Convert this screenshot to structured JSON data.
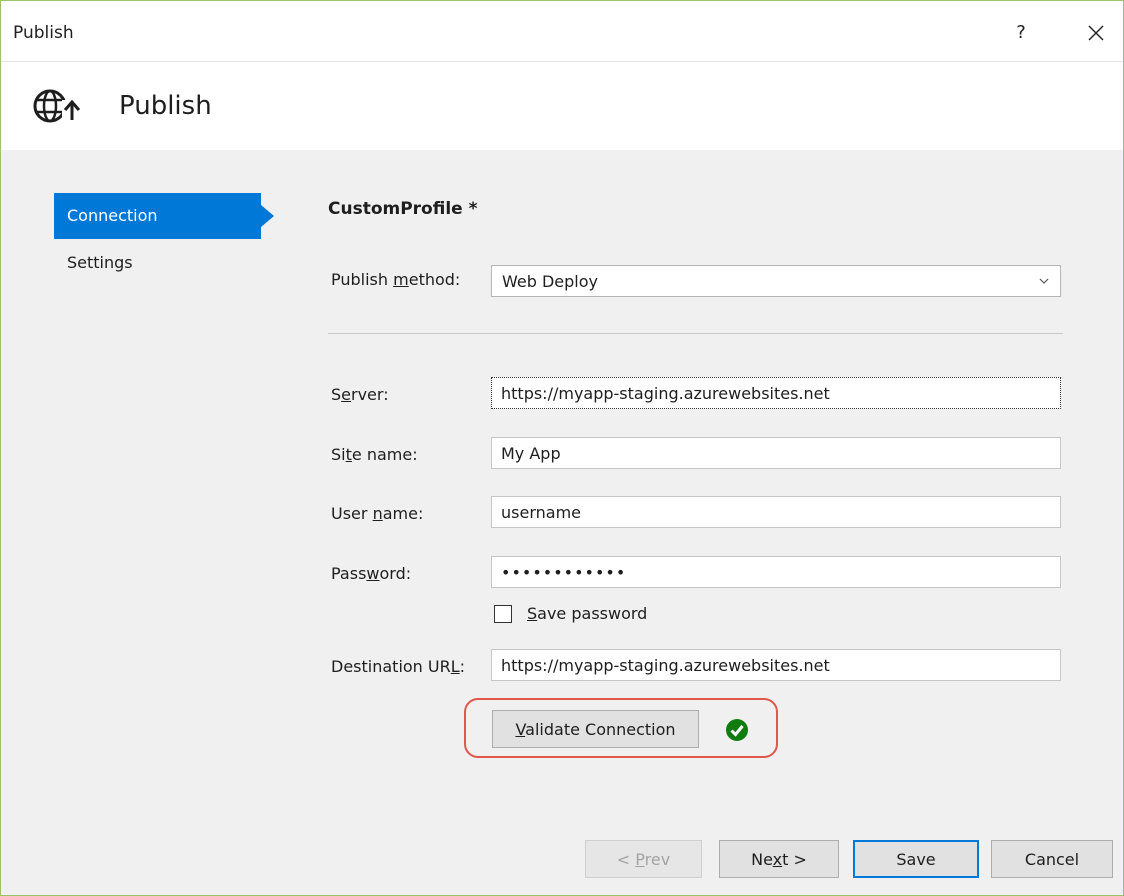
{
  "window": {
    "title": "Publish",
    "help_label": "?"
  },
  "header": {
    "title": "Publish",
    "icon": "globe-publish-icon"
  },
  "nav": {
    "items": [
      {
        "label": "Connection",
        "active": true
      },
      {
        "label": "Settings",
        "active": false
      }
    ]
  },
  "profile": {
    "title": "CustomProfile *"
  },
  "form": {
    "publish_method": {
      "label_pre": "Publish ",
      "label_key": "m",
      "label_post": "ethod:",
      "value": "Web Deploy"
    },
    "server": {
      "label_pre": "S",
      "label_key": "e",
      "label_post": "rver:",
      "value": "https://myapp-staging.azurewebsites.net"
    },
    "site_name": {
      "label_pre": "Si",
      "label_key": "t",
      "label_post": "e name:",
      "value": "My App"
    },
    "user_name": {
      "label_pre": "User ",
      "label_key": "n",
      "label_post": "ame:",
      "value": "username"
    },
    "password": {
      "label_pre": "Pass",
      "label_key": "w",
      "label_post": "ord:",
      "value": "••••••••••••"
    },
    "save_password": {
      "label_key": "S",
      "label_post": "ave password",
      "checked": false
    },
    "destination_url": {
      "label_pre": "Destination UR",
      "label_key": "L",
      "label_post": ":",
      "value": "https://myapp-staging.azurewebsites.net"
    }
  },
  "validate": {
    "label_key": "V",
    "label_post": "alidate Connection",
    "status": "success",
    "status_color": "#107c10"
  },
  "footer": {
    "prev": {
      "label_pre": "< ",
      "label_key": "P",
      "label_post": "rev",
      "enabled": false
    },
    "next": {
      "label_pre": "Ne",
      "label_key": "x",
      "label_post": "t >"
    },
    "save": {
      "label": "Save"
    },
    "cancel": {
      "label": "Cancel"
    }
  },
  "colors": {
    "accent": "#0078d7",
    "highlight_ring": "#e0574b",
    "window_border": "#9bc466"
  }
}
